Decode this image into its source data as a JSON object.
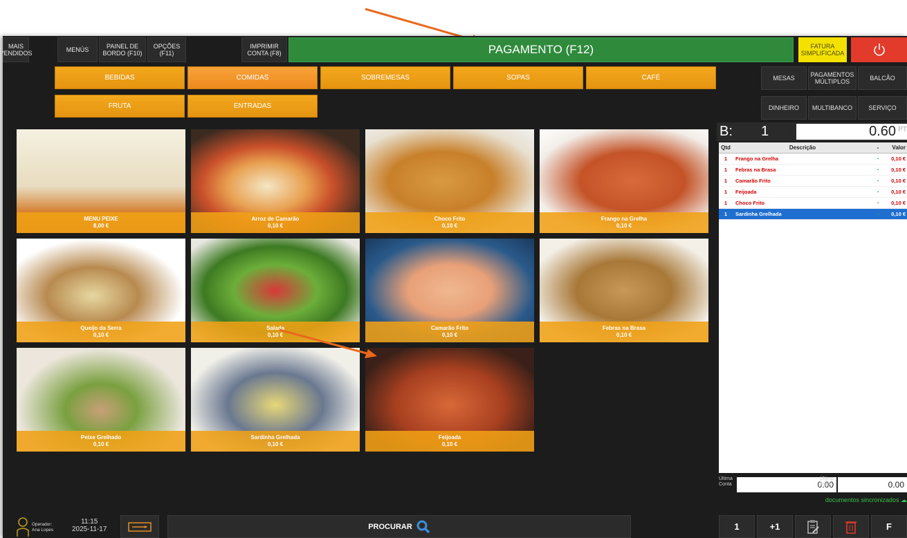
{
  "topbar": {
    "mais_vendidos": "MAIS\nVENDIDOS",
    "menus": "MENÚS",
    "painel": "PAINEL DE\nBORDO (F10)",
    "opcoes": "OPÇÕES\n(F11)",
    "imprimir": "IMPRIMIR\nCONTA (F8)",
    "pagamento": "PAGAMENTO (F12)",
    "fatura": "FATURA\nSIMPLIFICADA",
    "power_icon": "power-icon"
  },
  "categories": [
    "BEBIDAS",
    "COMIDAS",
    "SOBREMESAS",
    "SOPAS",
    "CAFÉ",
    "FRUTA",
    "ENTRADAS"
  ],
  "active_category": "COMIDAS",
  "right_buttons": {
    "mesas": "MESAS",
    "pagamentos": "PAGAMENTOS\nMÚLTIPLOS",
    "balcao": "BALCÃO",
    "dinheiro": "DINHEIRO",
    "multibanco": "MULTIBANCO",
    "servico": "SERVIÇO"
  },
  "products": [
    {
      "name": "MENU PEIXE",
      "price": "8,00 €"
    },
    {
      "name": "Arroz de Camarão",
      "price": "0,10 €"
    },
    {
      "name": "Choco Frito",
      "price": "0,10 €"
    },
    {
      "name": "Frango na Grelha",
      "price": "0,10 €"
    },
    {
      "name": "Queijo da Serra",
      "price": "0,10 €"
    },
    {
      "name": "Salada",
      "price": "0,10 €"
    },
    {
      "name": "Camarão Frito",
      "price": "0,10 €"
    },
    {
      "name": "Febras na Brasa",
      "price": "0,10 €"
    },
    {
      "name": "Peixe Grelhado",
      "price": "0,10 €"
    },
    {
      "name": "Sardinha Grelhada",
      "price": "0,10 €"
    },
    {
      "name": "Feijoada",
      "price": "0,10 €"
    }
  ],
  "order": {
    "table_label": "B:",
    "table_number": "1",
    "total": "0.60",
    "total_unit": "PT",
    "columns": [
      "Qtd",
      "Descrição",
      "-",
      "Valor"
    ],
    "rows": [
      {
        "qty": "1",
        "desc": "Frango na Grelha",
        "value": "0,10 €",
        "selected": false
      },
      {
        "qty": "1",
        "desc": "Febras na Brasa",
        "value": "0,10 €",
        "selected": false
      },
      {
        "qty": "1",
        "desc": "Camarão Frito",
        "value": "0,10 €",
        "selected": false
      },
      {
        "qty": "1",
        "desc": "Feijoada",
        "value": "0,10 €",
        "selected": false
      },
      {
        "qty": "1",
        "desc": "Choco Frito",
        "value": "0,10 €",
        "selected": false
      },
      {
        "qty": "1",
        "desc": "Sardinha Grelhada",
        "value": "0,10 €",
        "selected": true
      }
    ],
    "ultima_conta_label": "Última\nConta",
    "ultima_conta": "0.00",
    "ultimo_troco_label": "Último\nTroco",
    "ultimo_troco": "0.00",
    "sync_status": "documentos sincronizados"
  },
  "bottombar": {
    "operator_label": "Operador:",
    "operator_name": "Ana Lopes",
    "time": "11:15",
    "date": "2025-11-17",
    "procurar": "PROCURAR",
    "btn_one": "1",
    "btn_plus_one": "+1",
    "btn_f": "F"
  },
  "colors": {
    "accent_orange": "#f3a81d",
    "pay_green": "#2f8a3c",
    "power_red": "#e23a2b",
    "selected_blue": "#1f6fd0",
    "annotation_arrow": "#e8691c"
  }
}
